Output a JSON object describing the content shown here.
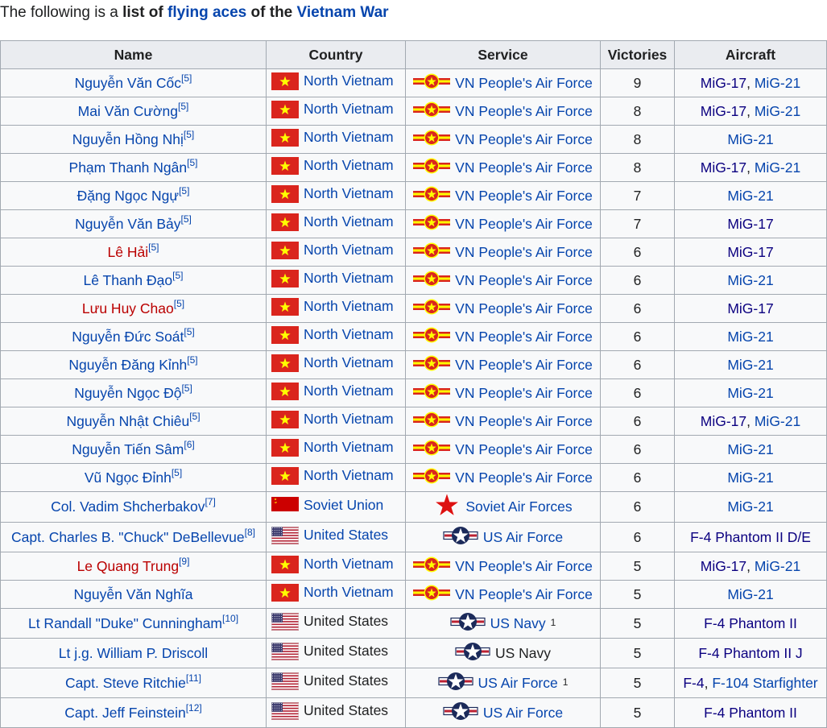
{
  "intro": {
    "prefix": "The following is a ",
    "bold_list": "list of",
    "space": " ",
    "link_flying_aces": "flying aces",
    "of_the": " of the ",
    "link_vietnam_war": "Vietnam War"
  },
  "table": {
    "headers": [
      "Name",
      "Country",
      "Service",
      "Victories",
      "Aircraft"
    ],
    "rows": [
      {
        "name": "Nguyễn Văn Cốc",
        "ref": "[5]",
        "name_red": false,
        "country": "North Vietnam",
        "flag": "vn",
        "service": "VN People's Air Force",
        "service_icon": "vpaf-roundel",
        "service_sup": "",
        "victories": "9",
        "aircraft": [
          "MiG-17",
          "MiG-21"
        ],
        "aircraft_sep": ", "
      },
      {
        "name": "Mai Văn Cường",
        "ref": "[5]",
        "name_red": false,
        "country": "North Vietnam",
        "flag": "vn",
        "service": "VN People's Air Force",
        "service_icon": "vpaf-roundel",
        "service_sup": "",
        "victories": "8",
        "aircraft": [
          "MiG-17",
          "MiG-21"
        ],
        "aircraft_sep": ", "
      },
      {
        "name": "Nguyễn Hồng Nhị",
        "ref": "[5]",
        "name_red": false,
        "country": "North Vietnam",
        "flag": "vn",
        "service": "VN People's Air Force",
        "service_icon": "vpaf-roundel",
        "service_sup": "",
        "victories": "8",
        "aircraft": [
          "MiG-21"
        ],
        "aircraft_sep": ""
      },
      {
        "name": "Phạm Thanh Ngân",
        "ref": "[5]",
        "name_red": false,
        "country": "North Vietnam",
        "flag": "vn",
        "service": "VN People's Air Force",
        "service_icon": "vpaf-roundel",
        "service_sup": "",
        "victories": "8",
        "aircraft": [
          "MiG-17",
          "MiG-21"
        ],
        "aircraft_sep": ", "
      },
      {
        "name": "Đặng Ngọc Ngự",
        "ref": "[5]",
        "name_red": false,
        "country": "North Vietnam",
        "flag": "vn",
        "service": "VN People's Air Force",
        "service_icon": "vpaf-roundel",
        "service_sup": "",
        "victories": "7",
        "aircraft": [
          "MiG-21"
        ],
        "aircraft_sep": ""
      },
      {
        "name": "Nguyễn Văn Bảy",
        "ref": "[5]",
        "name_red": false,
        "country": "North Vietnam",
        "flag": "vn",
        "service": "VN People's Air Force",
        "service_icon": "vpaf-roundel",
        "service_sup": "",
        "victories": "7",
        "aircraft": [
          "MiG-17"
        ],
        "aircraft_sep": ""
      },
      {
        "name": "Lê Hải",
        "ref": "[5]",
        "name_red": true,
        "country": "North Vietnam",
        "flag": "vn",
        "service": "VN People's Air Force",
        "service_icon": "vpaf-roundel",
        "service_sup": "",
        "victories": "6",
        "aircraft": [
          "MiG-17"
        ],
        "aircraft_sep": ""
      },
      {
        "name": "Lê Thanh Đạo",
        "ref": "[5]",
        "name_red": false,
        "country": "North Vietnam",
        "flag": "vn",
        "service": "VN People's Air Force",
        "service_icon": "vpaf-roundel",
        "service_sup": "",
        "victories": "6",
        "aircraft": [
          "MiG-21"
        ],
        "aircraft_sep": ""
      },
      {
        "name": "Lưu Huy Chao",
        "ref": "[5]",
        "name_red": true,
        "country": "North Vietnam",
        "flag": "vn",
        "service": "VN People's Air Force",
        "service_icon": "vpaf-roundel",
        "service_sup": "",
        "victories": "6",
        "aircraft": [
          "MiG-17"
        ],
        "aircraft_sep": ""
      },
      {
        "name": "Nguyễn Đức Soát",
        "ref": "[5]",
        "name_red": false,
        "country": "North Vietnam",
        "flag": "vn",
        "service": "VN People's Air Force",
        "service_icon": "vpaf-roundel",
        "service_sup": "",
        "victories": "6",
        "aircraft": [
          "MiG-21"
        ],
        "aircraft_sep": ""
      },
      {
        "name": "Nguyễn Đăng Kỉnh",
        "ref": "[5]",
        "name_red": false,
        "country": "North Vietnam",
        "flag": "vn",
        "service": "VN People's Air Force",
        "service_icon": "vpaf-roundel",
        "service_sup": "",
        "victories": "6",
        "aircraft": [
          "MiG-21"
        ],
        "aircraft_sep": ""
      },
      {
        "name": "Nguyễn Ngọc Độ",
        "ref": "[5]",
        "name_red": false,
        "country": "North Vietnam",
        "flag": "vn",
        "service": "VN People's Air Force",
        "service_icon": "vpaf-roundel",
        "service_sup": "",
        "victories": "6",
        "aircraft": [
          "MiG-21"
        ],
        "aircraft_sep": ""
      },
      {
        "name": "Nguyễn Nhật Chiêu",
        "ref": "[5]",
        "name_red": false,
        "country": "North Vietnam",
        "flag": "vn",
        "service": "VN People's Air Force",
        "service_icon": "vpaf-roundel",
        "service_sup": "",
        "victories": "6",
        "aircraft": [
          "MiG-17",
          "MiG-21"
        ],
        "aircraft_sep": ", "
      },
      {
        "name": "Nguyễn Tiến Sâm",
        "ref": "[6]",
        "name_red": false,
        "country": "North Vietnam",
        "flag": "vn",
        "service": "VN People's Air Force",
        "service_icon": "vpaf-roundel",
        "service_sup": "",
        "victories": "6",
        "aircraft": [
          "MiG-21"
        ],
        "aircraft_sep": ""
      },
      {
        "name": "Vũ Ngọc Đỉnh",
        "ref": "[5]",
        "name_red": false,
        "country": "North Vietnam",
        "flag": "vn",
        "service": "VN People's Air Force",
        "service_icon": "vpaf-roundel",
        "service_sup": "",
        "victories": "6",
        "aircraft": [
          "MiG-21"
        ],
        "aircraft_sep": ""
      },
      {
        "name": "Col. Vadim Shcherbakov",
        "ref": "[7]",
        "name_red": false,
        "country": "Soviet Union",
        "flag": "su",
        "service": "Soviet Air Forces",
        "service_icon": "red-star",
        "service_sup": "",
        "victories": "6",
        "aircraft": [
          "MiG-21"
        ],
        "aircraft_sep": ""
      },
      {
        "name": "Capt. Charles B. \"Chuck\" DeBellevue",
        "ref": "[8]",
        "name_red": false,
        "country": "United States",
        "flag": "us",
        "service": "US Air Force",
        "service_icon": "us-roundel",
        "service_sup": "",
        "victories": "6",
        "aircraft": [
          "F-4 Phantom II D/E"
        ],
        "aircraft_sep": ""
      },
      {
        "name": "Le Quang Trung",
        "ref": "[9]",
        "name_red": true,
        "country": "North Vietnam",
        "flag": "vn",
        "service": "VN People's Air Force",
        "service_icon": "vpaf-roundel",
        "service_sup": "",
        "victories": "5",
        "aircraft": [
          "MiG-17",
          "MiG-21"
        ],
        "aircraft_sep": ", "
      },
      {
        "name": "Nguyễn Văn Nghĩa",
        "ref": "",
        "name_red": false,
        "country": "North Vietnam",
        "flag": "vn",
        "service": "VN People's Air Force",
        "service_icon": "vpaf-roundel",
        "service_sup": "",
        "victories": "5",
        "aircraft": [
          "MiG-21"
        ],
        "aircraft_sep": ""
      },
      {
        "name": "Lt Randall \"Duke\" Cunningham",
        "ref": "[10]",
        "name_red": false,
        "country": "United States",
        "flag": "us",
        "service": "US Navy",
        "service_icon": "us-roundel",
        "service_sup": "1",
        "victories": "5",
        "aircraft": [
          "F-4 Phantom II"
        ],
        "aircraft_sep": ""
      },
      {
        "name": "Lt j.g. William P. Driscoll",
        "ref": "",
        "name_red": false,
        "country": "United States",
        "flag": "us",
        "service": "US Navy",
        "service_icon": "us-roundel",
        "service_sup": "",
        "victories": "5",
        "aircraft": [
          "F-4 Phantom II J"
        ],
        "aircraft_sep": ""
      },
      {
        "name": "Capt. Steve Ritchie",
        "ref": "[11]",
        "name_red": false,
        "country": "United States",
        "flag": "us",
        "service": "US Air Force",
        "service_icon": "us-roundel",
        "service_sup": "1",
        "victories": "5",
        "aircraft": [
          "F-4",
          "F-104 Starfighter"
        ],
        "aircraft_sep": ", "
      },
      {
        "name": "Capt. Jeff Feinstein",
        "ref": "[12]",
        "name_red": false,
        "country": "United States",
        "flag": "us",
        "service": "US Air Force",
        "service_icon": "us-roundel",
        "service_sup": "",
        "victories": "5",
        "aircraft": [
          "F-4 Phantom II"
        ],
        "aircraft_sep": ""
      }
    ]
  },
  "colors": {
    "link": "#0645ad",
    "redlink": "#ba0000",
    "header_bg": "#eaecf0",
    "cell_bg": "#f8f9fa",
    "border": "#a2a9b1"
  }
}
